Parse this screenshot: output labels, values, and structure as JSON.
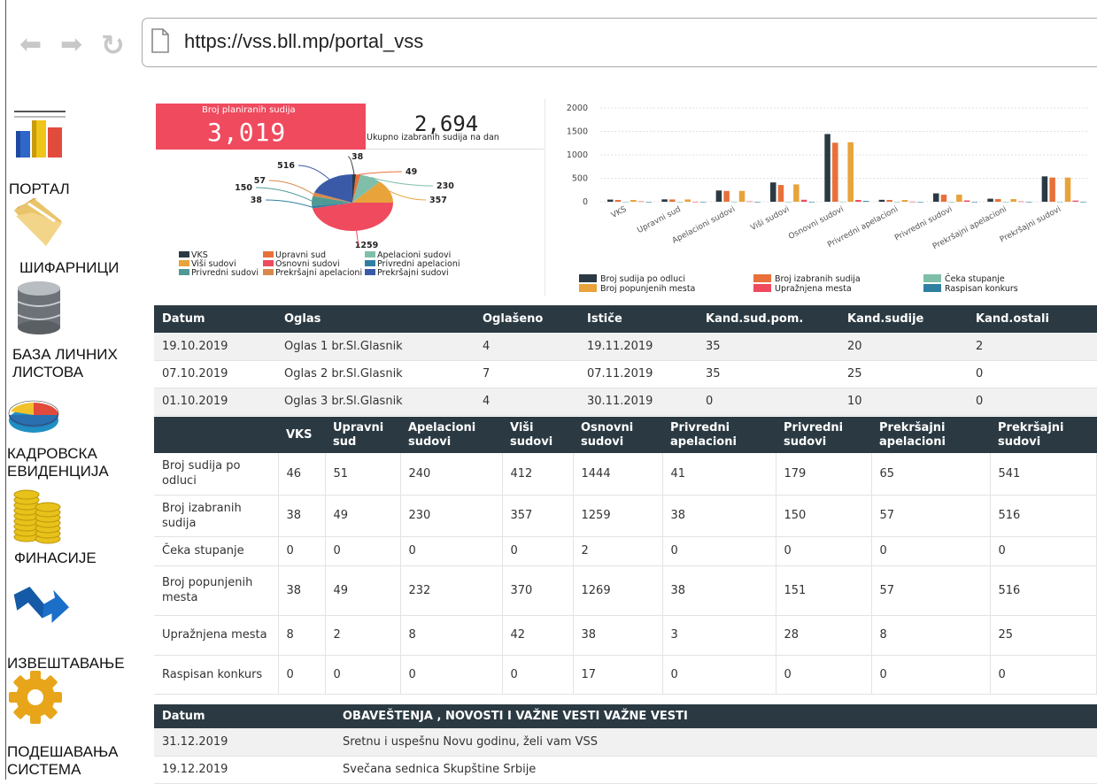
{
  "browser": {
    "url": "https://vss.bll.mp/portal_vss"
  },
  "sidebar": {
    "items": [
      {
        "label": "ПОРТАЛ",
        "icon": "bar-chart-icon"
      },
      {
        "label": "ШИФАРНИЦИ",
        "icon": "folder-icon"
      },
      {
        "label": "БАЗА ЛИЧНИХ\n ЛИСТОВА",
        "icon": "database-icon"
      },
      {
        "label": "КАДРОВСКА\nЕВИДЕНЦИЈА",
        "icon": "pie-chart-icon"
      },
      {
        "label": "ФИНАСИЈЕ",
        "icon": "coins-icon"
      },
      {
        "label": "ИЗВЕШТАВАЊЕ",
        "icon": "trend-arrow-icon"
      },
      {
        "label": "ПОДЕШАВАЊА\nСИСТЕМА",
        "icon": "gear-icon"
      }
    ]
  },
  "kpi": {
    "planned_label": "Broj planiranih sudija",
    "planned_value": "3,019",
    "elected_value": "2,694",
    "elected_label": "Ukupno izabranih sudija na dan"
  },
  "chart_data": [
    {
      "type": "pie",
      "labels": [
        "VKS",
        "Upravni sud",
        "Apelacioni sudovi",
        "Viši sudovi",
        "Osnovni sudovi",
        "Privredni apelacioni",
        "Privredni sudovi",
        "Prekršajni apelacioni",
        "Prekršajni sudovi"
      ],
      "values": [
        38,
        49,
        230,
        357,
        1259,
        38,
        150,
        57,
        516
      ],
      "colors": [
        "#2b3a42",
        "#e8703a",
        "#7fbfa9",
        "#e8a33a",
        "#ef4a5e",
        "#2f7fa1",
        "#4f9a94",
        "#d88a4c",
        "#3a5aa8"
      ],
      "legend_position": "bottom"
    },
    {
      "type": "bar",
      "categories": [
        "VKS",
        "Upravni sud",
        "Apelacioni sudovi",
        "Viši sudovi",
        "Osnovni sudovi",
        "Privredni apelacioni",
        "Privredni sudovi",
        "Prekršajni apelacioni",
        "Prekršajni sudovi"
      ],
      "series": [
        {
          "name": "Broj sudija po odluci",
          "color": "#2b3a42",
          "values": [
            46,
            51,
            240,
            412,
            1444,
            41,
            179,
            65,
            541
          ]
        },
        {
          "name": "Broj izabranih sudija",
          "color": "#e8703a",
          "values": [
            38,
            49,
            230,
            357,
            1259,
            38,
            150,
            57,
            516
          ]
        },
        {
          "name": "Čeka stupanje",
          "color": "#7fbfa9",
          "values": [
            0,
            0,
            0,
            0,
            2,
            0,
            0,
            0,
            0
          ]
        },
        {
          "name": "Broj popunjenih mesta",
          "color": "#e8a33a",
          "values": [
            38,
            49,
            232,
            370,
            1269,
            38,
            151,
            57,
            516
          ]
        },
        {
          "name": "Upražnjena mesta",
          "color": "#ef4a5e",
          "values": [
            8,
            2,
            8,
            42,
            38,
            3,
            28,
            8,
            25
          ]
        },
        {
          "name": "Raspisan konkurs",
          "color": "#2f7fa1",
          "values": [
            0,
            0,
            0,
            0,
            17,
            0,
            0,
            0,
            0
          ]
        }
      ],
      "ylim": [
        0,
        2000
      ],
      "yticks": [
        0,
        500,
        1000,
        1500,
        2000
      ],
      "grid": true,
      "legend_position": "bottom"
    }
  ],
  "ads_table": {
    "headers": [
      "Datum",
      "Oglas",
      "Oglašeno",
      "Ističe",
      "Kand.sud.pom.",
      "Kand.sudije",
      "Kand.ostali"
    ],
    "rows": [
      [
        "19.10.2019",
        "Oglas 1 br.Sl.Glasnik",
        "4",
        "19.11.2019",
        "35",
        "20",
        "2"
      ],
      [
        "07.10.2019",
        "Oglas 2 br.Sl.Glasnik",
        "7",
        "07.11.2019",
        "35",
        "25",
        "0"
      ],
      [
        "01.10.2019",
        "Oglas 3 br.Sl.Glasnik",
        "4",
        "30.11.2019",
        "0",
        "10",
        "0"
      ]
    ]
  },
  "stats_table": {
    "headers": [
      "",
      "VKS",
      "Upravni sud",
      "Apelacioni sudovi",
      "Viši sudovi",
      "Osnovni sudovi",
      "Privredni apelacioni",
      "Privredni sudovi",
      "Prekršajni apelacioni",
      "Prekršajni sudovi"
    ],
    "rows": [
      [
        "Broj sudija po odluci",
        "46",
        "51",
        "240",
        "412",
        "1444",
        "41",
        "179",
        "65",
        "541"
      ],
      [
        "Broj izabranih sudija",
        "38",
        "49",
        "230",
        "357",
        "1259",
        "38",
        "150",
        "57",
        "516"
      ],
      [
        "Čeka stupanje",
        "0",
        "0",
        "0",
        "0",
        "2",
        "0",
        "0",
        "0",
        "0"
      ],
      [
        "Broj popunjenih mesta",
        "38",
        "49",
        "232",
        "370",
        "1269",
        "38",
        "151",
        "57",
        "516"
      ],
      [
        "Upražnjena mesta",
        "8",
        "2",
        "8",
        "42",
        "38",
        "3",
        "28",
        "8",
        "25"
      ],
      [
        "Raspisan konkurs",
        "0",
        "0",
        "0",
        "0",
        "17",
        "0",
        "0",
        "0",
        "0"
      ]
    ]
  },
  "news_table": {
    "headers": [
      "Datum",
      "OBAVEŠTENJA , NOVOSTI I VAŽNE VESTI VAŽNE VESTI"
    ],
    "rows": [
      [
        "31.12.2019",
        "Sretnu i uspešnu Novu godinu, želi vam VSS"
      ],
      [
        "19.12.2019",
        "Svečana sednica Skupštine Srbije"
      ]
    ]
  }
}
